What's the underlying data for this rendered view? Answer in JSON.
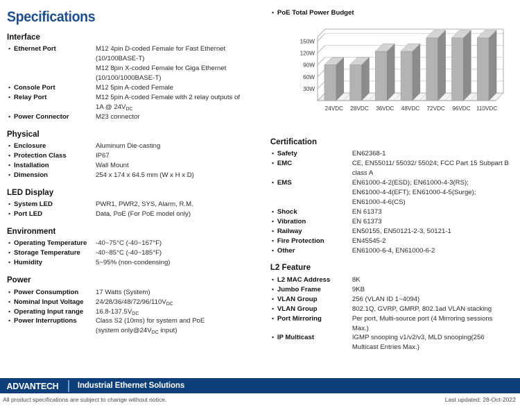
{
  "title": "Specifications",
  "sections_left": [
    {
      "title": "Interface",
      "rows": [
        {
          "label": "Ethernet Port",
          "value": "M12 4pin D-coded Female for Fast Ethernet\n(10/100BASE-T)\nM12 8pin X-coded Female for Giga Ethernet\n(10/100/1000BASE-T)"
        },
        {
          "label": "Console Port",
          "value": "M12 5pin A-coded Female"
        },
        {
          "label": "Relay Port",
          "value": "M12 5pin A-coded Female with 2 relay outputs of\n1A @ 24VDC",
          "sub": "DC"
        },
        {
          "label": "Power Connector",
          "value": "M23 connector"
        }
      ]
    },
    {
      "title": "Physical",
      "rows": [
        {
          "label": "Enclosure",
          "value": "Aluminum Die-casting"
        },
        {
          "label": "Protection Class",
          "value": "IP67"
        },
        {
          "label": "Installation",
          "value": "Wall Mount"
        },
        {
          "label": "Dimension",
          "value": "254 x 174 x 64.5 mm (W x H x D)"
        }
      ]
    },
    {
      "title": "LED Display",
      "rows": [
        {
          "label": "System LED",
          "value": "PWR1, PWR2, SYS, Alarm, R.M."
        },
        {
          "label": "Port LED",
          "value": "Data, PoE (For PoE model only)"
        }
      ]
    },
    {
      "title": "Environment",
      "rows": [
        {
          "label": "Operating Temperature",
          "value": "-40~75°C (-40~167°F)"
        },
        {
          "label": "Storage Temperature",
          "value": "-40~85°C (-40~185°F)"
        },
        {
          "label": "Humidity",
          "value": "5~95% (non-condensing)"
        }
      ]
    },
    {
      "title": "Power",
      "rows": [
        {
          "label": "Power Consumption",
          "value": "17 Watts (System)"
        },
        {
          "label": "Nominal Input Voltage",
          "value": "24/28/36/48/72/96/110VDC"
        },
        {
          "label": "Operating Input range",
          "value": "16.8-137.5VDC"
        },
        {
          "label": "Power Interruptions",
          "value": "Class S2 (10ms) for system and PoE\n(system only@24VDC input)"
        }
      ]
    }
  ],
  "chart_heading": "PoE Total Power Budget",
  "chart_data": {
    "type": "bar",
    "title": "PoE Total Power Budget",
    "categories": [
      "24VDC",
      "28VDC",
      "36VDC",
      "48VDC",
      "72VDC",
      "96VDC",
      "110VDC"
    ],
    "values": [
      90,
      90,
      124,
      124,
      158,
      158,
      158
    ],
    "xlabel": "",
    "ylabel": "",
    "ylim": [
      0,
      180
    ],
    "yticks": [
      30,
      60,
      90,
      120,
      150
    ],
    "ytick_labels": [
      "30W",
      "60W",
      "90W",
      "120W",
      "150W"
    ],
    "grid": true,
    "legend": "none",
    "bar_face_color": "#b3b3b3",
    "bar_side_color": "#8c8c8c",
    "bar_top_color": "#d4d4d4",
    "grid_color": "#cccccc",
    "axis_color": "#999999"
  },
  "sections_right": [
    {
      "title": "Certification",
      "rows": [
        {
          "label": "Safety",
          "value": "EN62368-1"
        },
        {
          "label": "EMC",
          "value": "CE, EN55011/ 55032/ 55024; FCC Part 15 Subpart B\nclass A"
        },
        {
          "label": "EMS",
          "value": "EN61000-4-2(ESD); EN61000-4-3(RS);\nEN61000-4-4(EFT); EN61000-4-5(Surge);\nEN61000-4-6(CS)"
        },
        {
          "label": "Shock",
          "value": "EN 61373"
        },
        {
          "label": "Vibration",
          "value": "EN 61373"
        },
        {
          "label": "Railway",
          "value": "EN50155, EN50121-2-3, 50121-1"
        },
        {
          "label": "Fire Protection",
          "value": "EN45545-2"
        },
        {
          "label": "Other",
          "value": "EN61000-6-4, EN61000-6-2"
        }
      ]
    },
    {
      "title": "L2 Feature",
      "rows": [
        {
          "label": "L2 MAC Address",
          "value": "8K"
        },
        {
          "label": "Jumbo Frame",
          "value": "9KB"
        },
        {
          "label": "VLAN Group",
          "value": "256 (VLAN ID 1~4094)"
        },
        {
          "label": "VLAN Group",
          "value": "802.1Q, GVRP, GMRP, 802.1ad VLAN stacking"
        },
        {
          "label": "Port Mirroring",
          "value": "Per port, Multi-source port (4 Mirroring sessions\nMax.)"
        },
        {
          "label": "IP Multicast",
          "value": "IGMP snooping v1/v2/v3, MLD snooping(256\nMulticast Entries Max.)"
        }
      ]
    }
  ],
  "footer": {
    "logo": "ADVANTECH",
    "tagline": "Industrial Ethernet Solutions",
    "disclaimer": "All product specifications are subject to change without notice.",
    "last_updated": "Last updated: 28-Oct-2022",
    "bar_color": "#0f3f7a"
  }
}
